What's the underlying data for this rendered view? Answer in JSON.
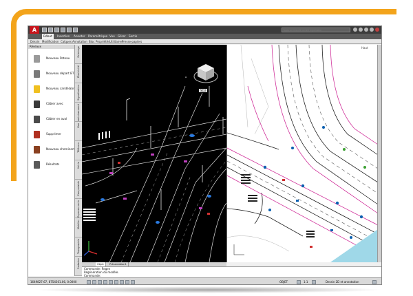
{
  "app": {
    "logo_letter": "A",
    "search_placeholder": "Tapez un mot-clé ou une expression"
  },
  "ribbon": {
    "tabs": [
      {
        "label": "Début",
        "active": true
      },
      {
        "label": "Insertion",
        "active": false
      },
      {
        "label": "Annoter",
        "active": false
      },
      {
        "label": "Paramétrique",
        "active": false
      },
      {
        "label": "Vue",
        "active": false
      },
      {
        "label": "Gérer",
        "active": false
      },
      {
        "label": "Sortie",
        "active": false
      }
    ],
    "panels": [
      "Dessin",
      "Modification",
      "Calques",
      "Annotation",
      "Bloc",
      "Propriétés",
      "Utilitaires",
      "Presse-papiers"
    ]
  },
  "palette": {
    "title": "Réseaux",
    "items": [
      {
        "label": "Nouveau Poteau",
        "icon": "pole-icon",
        "color": "#9a9a9a"
      },
      {
        "label": "Nouveau départ BT",
        "icon": "cabinet-icon",
        "color": "#7a7a7a"
      },
      {
        "label": "Nouveau candélabre",
        "icon": "lamp-icon",
        "color": "#f0c020"
      },
      {
        "label": "Câbler avec",
        "icon": "cable-icon",
        "color": "#3a3a3a"
      },
      {
        "label": "Câbler en aval",
        "icon": "cable-down-icon",
        "color": "#4a4a4a"
      },
      {
        "label": "Supprimer",
        "icon": "delete-icon",
        "color": "#b03020"
      },
      {
        "label": "Nouveau cheminement",
        "icon": "path-icon",
        "color": "#8a4020"
      },
      {
        "label": "Résultats",
        "icon": "results-icon",
        "color": "#5a5a5a"
      }
    ],
    "vertical_tabs": [
      "Eclairage",
      "Électricité",
      "Signalisation",
      "Assainissement",
      "Gaz",
      "Télécom",
      "Voirie",
      "Eau potable",
      "Espaces verts",
      "Mobilier",
      "Topographie",
      "Cadastre"
    ]
  },
  "viewport": {
    "view_label": "Haut",
    "navcube_label": "SCU"
  },
  "layouts": {
    "tabs": [
      "Objet",
      "Présentation1"
    ]
  },
  "command": {
    "lines": [
      "Commande: Regen",
      "Régénération du modèle.",
      "Commande:"
    ]
  },
  "status": {
    "coords": "1649827.67, 8754301.06, 0.0000",
    "model_label": "OBJET",
    "scale": "1:1",
    "workspace": "Dessin 2D et annotation"
  },
  "colors": {
    "frame_orange": "#f3a41b",
    "road_magenta": "#d0309a",
    "water_blue": "#0a5fb0",
    "tree_green": "#3aa030"
  }
}
